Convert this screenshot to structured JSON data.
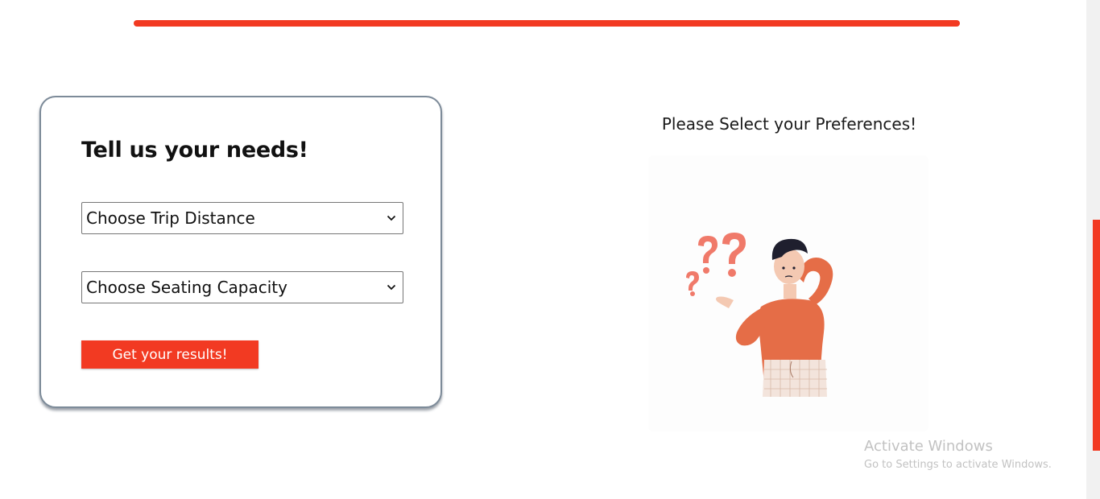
{
  "progress": {
    "fraction": 1.0,
    "color": "#f23a22"
  },
  "form": {
    "title": "Tell us your needs!",
    "trip_distance": {
      "selected": "Choose Trip Distance"
    },
    "seating_capacity": {
      "selected": "Choose Seating Capacity"
    },
    "submit_label": "Get your results!"
  },
  "preview": {
    "heading": "Please Select your Preferences!",
    "illustration": "confused-man-with-question-marks"
  },
  "watermark": {
    "title": "Activate Windows",
    "subtitle": "Go to Settings to activate Windows."
  },
  "colors": {
    "accent": "#f23a22",
    "shirt": "#e56d47",
    "question_marks": "#f07a6a"
  }
}
